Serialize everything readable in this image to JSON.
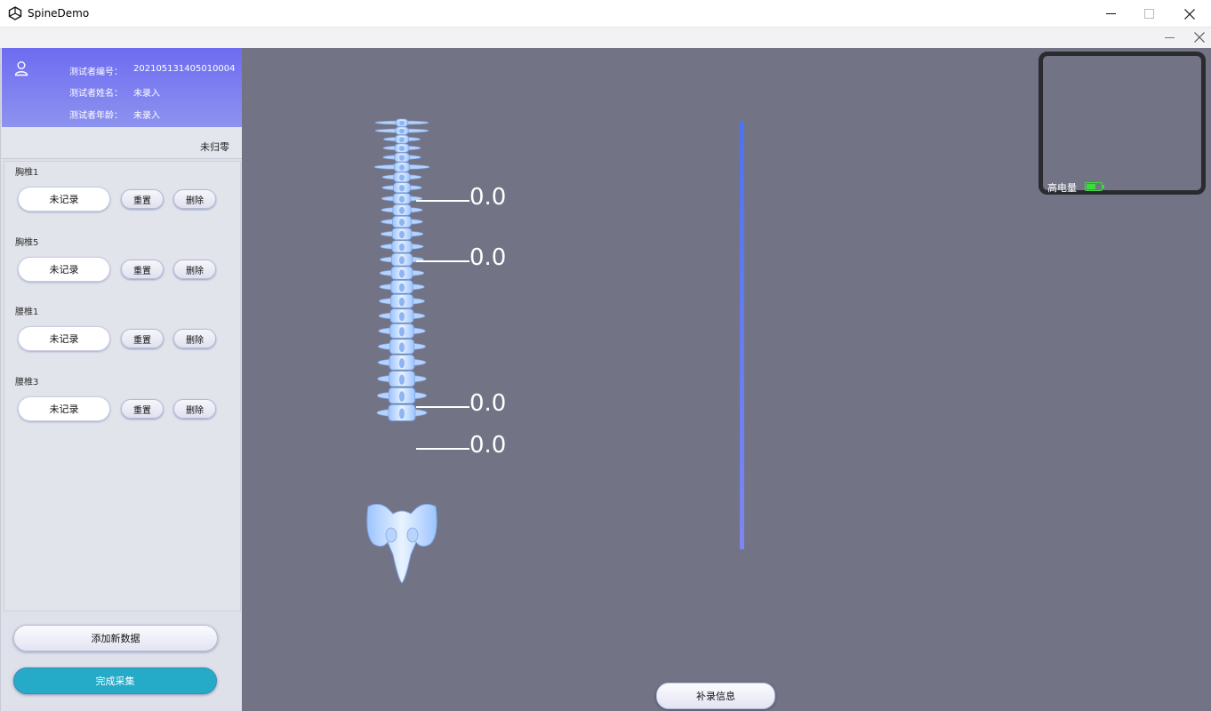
{
  "window": {
    "title": "SpineDemo"
  },
  "user": {
    "id_label": "测试者编号：",
    "id_value": "202105131405010004",
    "name_label": "测试者姓名：",
    "name_value": "未录入",
    "age_label": "测试者年龄：",
    "age_value": "未录入"
  },
  "status": {
    "not_zeroed": "未归零"
  },
  "groups": [
    {
      "label": "胸椎1",
      "record": "未记录",
      "reset": "重置",
      "delete": "删除"
    },
    {
      "label": "胸椎5",
      "record": "未记录",
      "reset": "重置",
      "delete": "删除"
    },
    {
      "label": "腰椎1",
      "record": "未记录",
      "reset": "重置",
      "delete": "删除"
    },
    {
      "label": "腰椎3",
      "record": "未记录",
      "reset": "重置",
      "delete": "删除"
    }
  ],
  "actions": {
    "add_data": "添加新数据",
    "finish": "完成采集",
    "supplement": "补录信息"
  },
  "readings": [
    "0.0",
    "0.0",
    "0.0",
    "0.0"
  ],
  "battery": {
    "label": "高电量",
    "level": 0.6,
    "color": "#3adc3a"
  },
  "colors": {
    "header_gradient_top": "#6d6cf0",
    "header_gradient_bottom": "#8d93ef",
    "finish_button": "#25aac8",
    "viewport_bg": "#727486",
    "level_bar": "#4e73f0"
  }
}
